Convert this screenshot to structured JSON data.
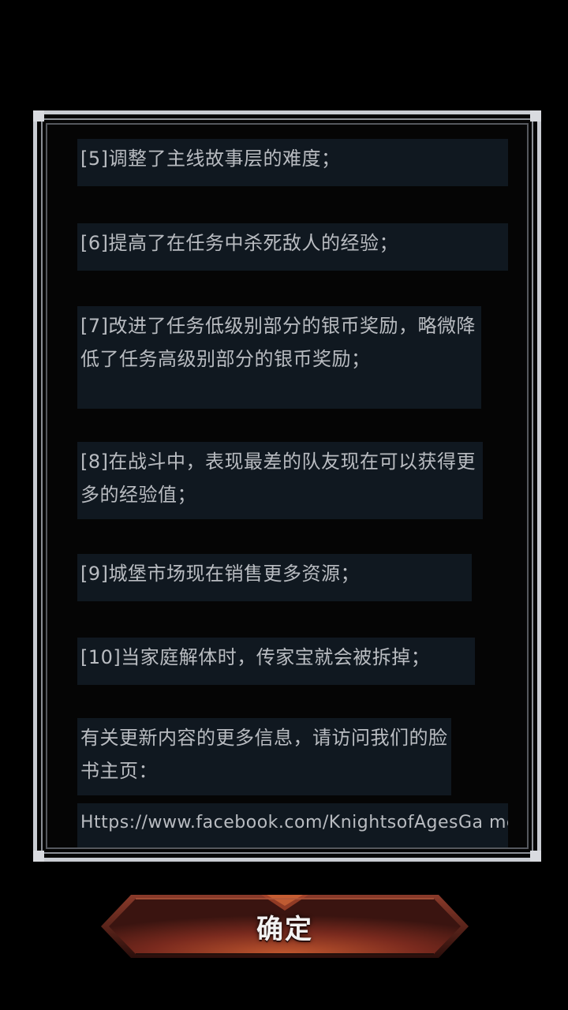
{
  "dialog": {
    "notes": [
      "[5]调整了主线故事层的难度；",
      "[6]提高了在任务中杀死敌人的经验；",
      "[7]改进了任务低级别部分的银币奖励，略微降低了任务高级别部分的银币奖励；",
      "[8]在战斗中，表现最差的队友现在可以获得更多的经验值；",
      "[9]城堡市场现在销售更多资源；",
      "[10]当家庭解体时，传家宝就会被拆掉；",
      "有关更新内容的更多信息，请访问我们的脸书主页：",
      "Https://www.facebook.com/KnightsofAgesGa me/"
    ]
  },
  "confirm_button": {
    "label": "确定"
  },
  "colors": {
    "background": "#000000",
    "frame": "#c9ccd2",
    "note_background": "#101820",
    "note_text": "#b9bcc1",
    "button_base": "#6b241c",
    "button_glow": "#c0572e"
  }
}
